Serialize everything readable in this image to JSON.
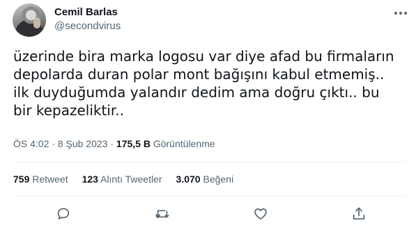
{
  "author": {
    "name": "Cemil Barlas",
    "handle": "@secondvirus"
  },
  "tweet": {
    "text": "üzerinde bira marka logosu var diye afad bu firmaların\ndepolarda duran polar mont bağışını kabul etmemiş..\nilk duyduğumda yalandır dedim ama doğru çıktı.. bu\nbir kepazeliktir.."
  },
  "meta": {
    "time": "ÖS 4:02",
    "separator": "·",
    "date": "8 Şub 2023",
    "views_count": "175,5 B",
    "views_label": "Görüntülenme"
  },
  "stats": {
    "retweets_count": "759",
    "retweets_label": "Retweet",
    "quotes_count": "123",
    "quotes_label": "Alıntı Tweetler",
    "likes_count": "3.070",
    "likes_label": "Beğeni"
  },
  "icons": {
    "more": "more-horizontal-icon",
    "reply": "reply-icon",
    "retweet": "retweet-icon",
    "like": "heart-icon",
    "share": "share-icon"
  },
  "colors": {
    "text_primary": "#0f1419",
    "text_secondary": "#536471",
    "divider": "#eff3f4"
  }
}
